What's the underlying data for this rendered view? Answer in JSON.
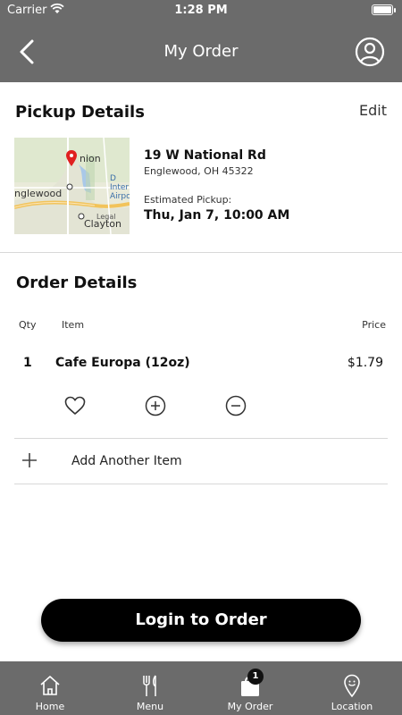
{
  "status_bar": {
    "carrier": "Carrier",
    "time": "1:28 PM"
  },
  "header": {
    "title": "My Order"
  },
  "pickup": {
    "title": "Pickup Details",
    "edit_label": "Edit",
    "address_line1": "19 W National Rd",
    "address_line2": "Englewood, OH 45322",
    "estimated_label": "Estimated Pickup:",
    "estimated_value": "Thu, Jan 7, 10:00 AM",
    "map_labels": [
      "nion",
      "nglewood",
      "D",
      "Inter",
      "Airpo",
      "Clayton",
      "Legal"
    ]
  },
  "order": {
    "title": "Order Details",
    "columns": {
      "qty": "Qty",
      "item": "Item",
      "price": "Price"
    },
    "items": [
      {
        "qty": "1",
        "name": "Cafe Europa  (12oz)",
        "price": "$1.79"
      }
    ],
    "add_item_label": "Add Another Item"
  },
  "login_button": "Login to Order",
  "tabbar": {
    "tabs": [
      {
        "label": "Home",
        "icon": "home-icon"
      },
      {
        "label": "Menu",
        "icon": "menu-icon"
      },
      {
        "label": "My Order",
        "icon": "bag-icon",
        "badge": "1"
      },
      {
        "label": "Location",
        "icon": "location-pin-icon"
      }
    ]
  },
  "colors": {
    "bar_gray": "#6b6b6b",
    "button_black": "#000000",
    "pin_red": "#e02020"
  }
}
